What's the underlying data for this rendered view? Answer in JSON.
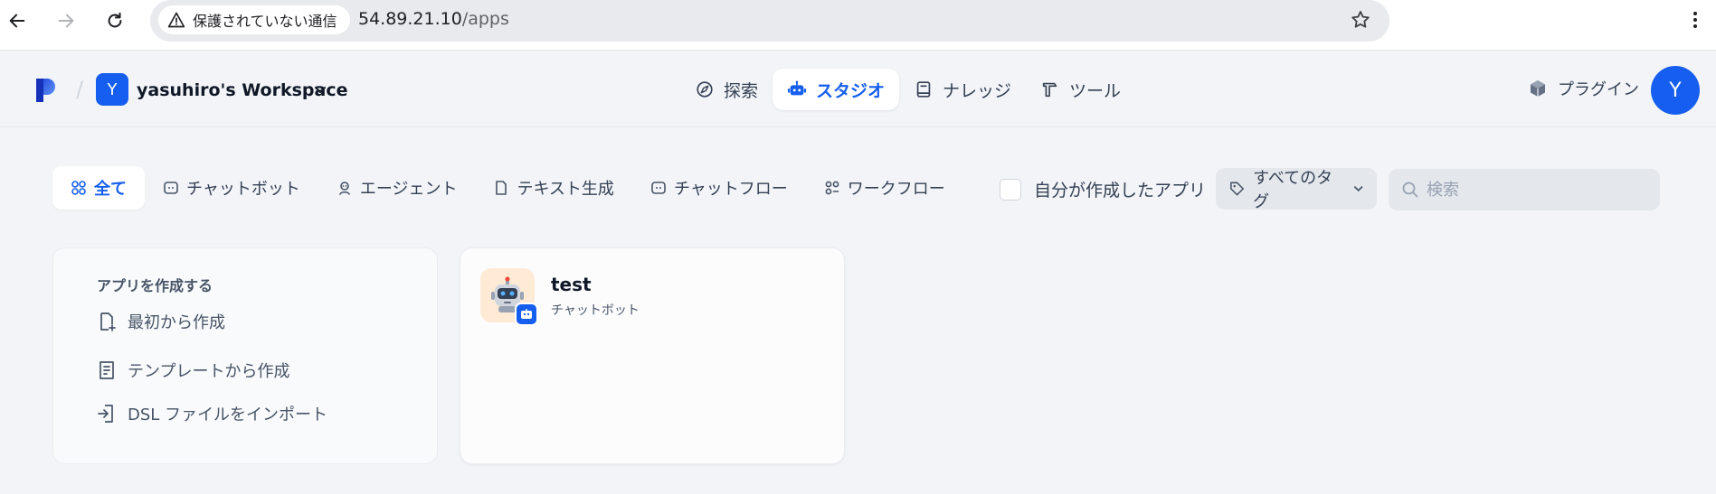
{
  "browser": {
    "security_label": "保護されていない通信",
    "url_host": "54.89.21.10",
    "url_path": "/apps"
  },
  "header": {
    "workspace_initial": "Y",
    "workspace_name": "yasuhiro's Workspace",
    "nav": [
      {
        "label": "探索",
        "icon": "compass-icon"
      },
      {
        "label": "スタジオ",
        "icon": "robot-icon",
        "active": true
      },
      {
        "label": "ナレッジ",
        "icon": "book-icon"
      },
      {
        "label": "ツール",
        "icon": "hammer-icon"
      }
    ],
    "plugin_label": "プラグイン",
    "user_initial": "Y"
  },
  "filters": {
    "tabs": [
      {
        "label": "全て",
        "icon": "grid-icon",
        "active": true
      },
      {
        "label": "チャットボット",
        "icon": "chat-bot-icon"
      },
      {
        "label": "エージェント",
        "icon": "agent-icon"
      },
      {
        "label": "テキスト生成",
        "icon": "document-icon"
      },
      {
        "label": "チャットフロー",
        "icon": "chat-flow-icon"
      },
      {
        "label": "ワークフロー",
        "icon": "workflow-icon"
      }
    ],
    "mine_label": "自分が作成したアプリ",
    "tags_label": "すべてのタグ",
    "search_placeholder": "検索"
  },
  "create": {
    "title": "アプリを作成する",
    "items": [
      "最初から作成",
      "テンプレートから作成",
      "DSL ファイルをインポート"
    ]
  },
  "apps": [
    {
      "name": "test",
      "type": "チャットボット"
    }
  ],
  "colors": {
    "accent": "#155eef",
    "page_bg": "#f2f4f7"
  }
}
